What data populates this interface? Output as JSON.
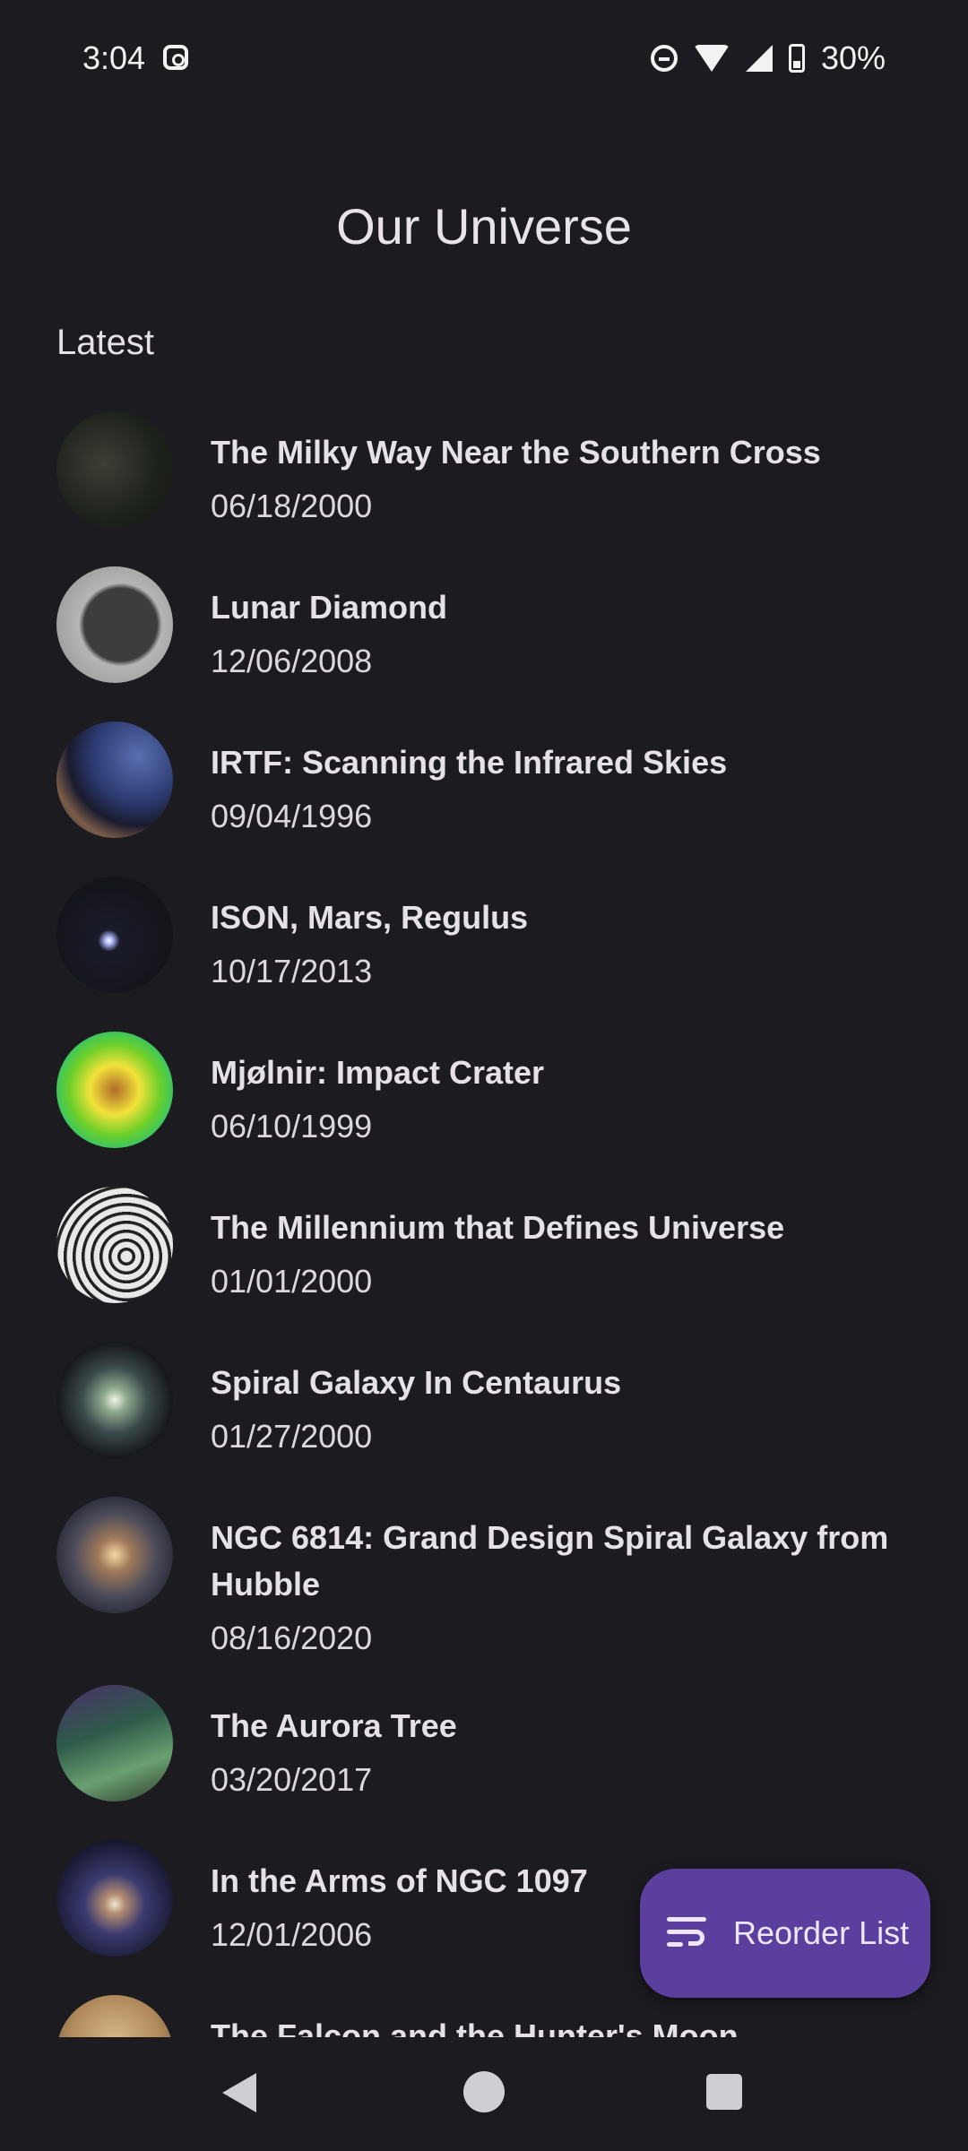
{
  "status_bar": {
    "time": "3:04",
    "battery": "30%",
    "icons": [
      "instagram-icon",
      "do-not-disturb-icon",
      "wifi-icon",
      "signal-icon",
      "battery-charging-icon"
    ]
  },
  "app": {
    "title": "Our Universe",
    "section_label": "Latest"
  },
  "items": [
    {
      "title": "The Milky Way Near the Southern Cross",
      "date": "06/18/2000"
    },
    {
      "title": "Lunar Diamond",
      "date": "12/06/2008"
    },
    {
      "title": "IRTF: Scanning the Infrared Skies",
      "date": "09/04/1996"
    },
    {
      "title": "ISON, Mars, Regulus",
      "date": "10/17/2013"
    },
    {
      "title": "Mjølnir: Impact Crater",
      "date": "06/10/1999"
    },
    {
      "title": "The Millennium that Defines Universe",
      "date": "01/01/2000"
    },
    {
      "title": "Spiral Galaxy In Centaurus",
      "date": "01/27/2000"
    },
    {
      "title": "NGC 6814: Grand Design Spiral Galaxy from Hubble",
      "date": "08/16/2020"
    },
    {
      "title": "The Aurora Tree",
      "date": "03/20/2017"
    },
    {
      "title": "In the Arms of NGC 1097",
      "date": "12/01/2006"
    },
    {
      "title": "The Falcon and the Hunter's Moon",
      "date": ""
    }
  ],
  "fab": {
    "label": "Reorder List",
    "icon": "reorder-list-icon",
    "color": "#5b3f9e"
  },
  "nav_bar": {
    "icons": [
      "back-icon",
      "home-icon",
      "recents-icon"
    ]
  }
}
